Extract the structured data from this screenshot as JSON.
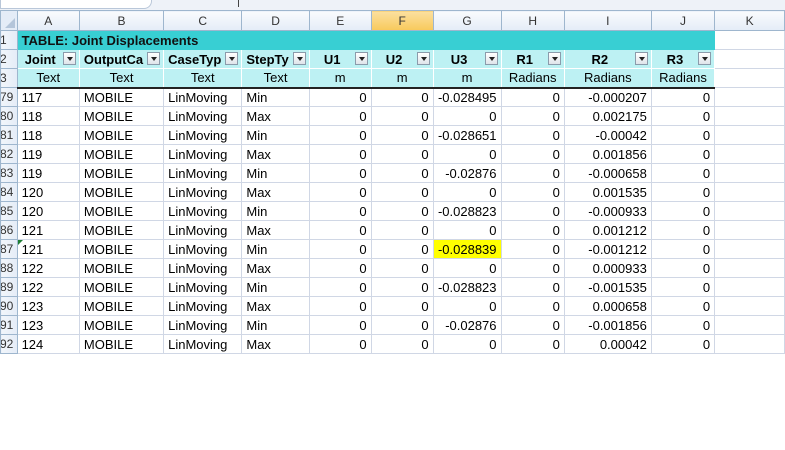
{
  "columns": [
    "A",
    "B",
    "C",
    "D",
    "E",
    "F",
    "G",
    "H",
    "I",
    "J",
    "K"
  ],
  "title": "TABLE:  Joint Displacements",
  "headers": [
    "Joint",
    "OutputCa",
    "CaseTyp",
    "StepTy",
    "U1",
    "U2",
    "U3",
    "R1",
    "R2",
    "R3"
  ],
  "units": [
    "Text",
    "Text",
    "Text",
    "Text",
    "m",
    "m",
    "m",
    "Radians",
    "Radians",
    "Radians"
  ],
  "row_numbers": [
    "1",
    "2",
    "3",
    "79",
    "80",
    "81",
    "82",
    "83",
    "84",
    "85",
    "86",
    "87",
    "88",
    "89",
    "90",
    "91",
    "92"
  ],
  "rows": [
    [
      "117",
      "MOBILE",
      "LinMoving",
      "Min",
      "0",
      "0",
      "-0.028495",
      "0",
      "-0.000207",
      "0"
    ],
    [
      "118",
      "MOBILE",
      "LinMoving",
      "Max",
      "0",
      "0",
      "0",
      "0",
      "0.002175",
      "0"
    ],
    [
      "118",
      "MOBILE",
      "LinMoving",
      "Min",
      "0",
      "0",
      "-0.028651",
      "0",
      "-0.00042",
      "0"
    ],
    [
      "119",
      "MOBILE",
      "LinMoving",
      "Max",
      "0",
      "0",
      "0",
      "0",
      "0.001856",
      "0"
    ],
    [
      "119",
      "MOBILE",
      "LinMoving",
      "Min",
      "0",
      "0",
      "-0.02876",
      "0",
      "-0.000658",
      "0"
    ],
    [
      "120",
      "MOBILE",
      "LinMoving",
      "Max",
      "0",
      "0",
      "0",
      "0",
      "0.001535",
      "0"
    ],
    [
      "120",
      "MOBILE",
      "LinMoving",
      "Min",
      "0",
      "0",
      "-0.028823",
      "0",
      "-0.000933",
      "0"
    ],
    [
      "121",
      "MOBILE",
      "LinMoving",
      "Max",
      "0",
      "0",
      "0",
      "0",
      "0.001212",
      "0"
    ],
    [
      "121",
      "MOBILE",
      "LinMoving",
      "Min",
      "0",
      "0",
      "-0.028839",
      "0",
      "-0.001212",
      "0"
    ],
    [
      "122",
      "MOBILE",
      "LinMoving",
      "Max",
      "0",
      "0",
      "0",
      "0",
      "0.000933",
      "0"
    ],
    [
      "122",
      "MOBILE",
      "LinMoving",
      "Min",
      "0",
      "0",
      "-0.028823",
      "0",
      "-0.001535",
      "0"
    ],
    [
      "123",
      "MOBILE",
      "LinMoving",
      "Max",
      "0",
      "0",
      "0",
      "0",
      "0.000658",
      "0"
    ],
    [
      "123",
      "MOBILE",
      "LinMoving",
      "Min",
      "0",
      "0",
      "-0.02876",
      "0",
      "-0.001856",
      "0"
    ],
    [
      "124",
      "MOBILE",
      "LinMoving",
      "Max",
      "0",
      "0",
      "0",
      "0",
      "0.00042",
      "0"
    ]
  ],
  "highlight_color": "#ffff00",
  "header_fill_color": "#38cfd3",
  "subheader_fill_color": "#bdf1f3",
  "selected_column": "F",
  "active_cell": "G87"
}
